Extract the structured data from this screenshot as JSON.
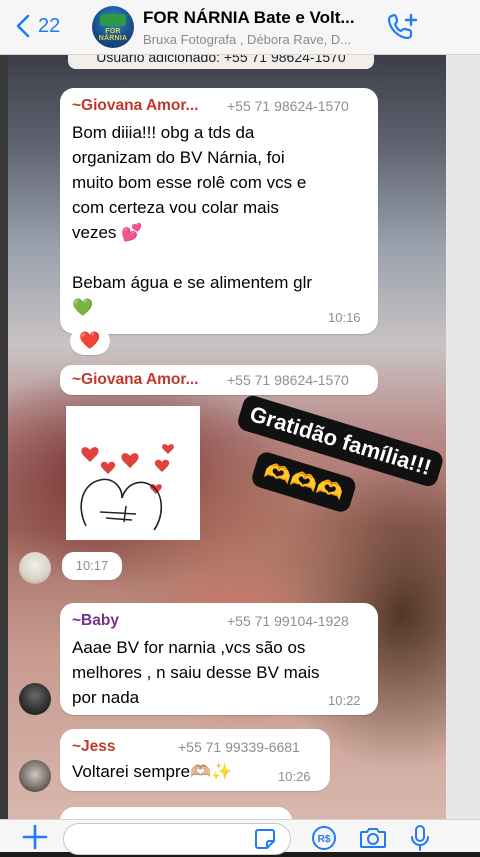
{
  "header": {
    "back_count": "22",
    "title": "FOR NÁRNIA Bate e Volt...",
    "subtitle": "Bruxa Fotografa , Débora Rave, D...",
    "avatar_logo_text": "FOR NÁRNIA",
    "icons": {
      "back": "chevron-left-icon",
      "call": "add-call-icon"
    }
  },
  "system_message": "Usuário adicionado: +55 71 98624-1570",
  "messages": [
    {
      "sender": "~Giovana Amor...",
      "phone": "+55 71 98624-1570",
      "sender_color": "#c0392b",
      "lines": [
        "Bom diiia!!! obg a tds da",
        "organizam do BV Nárnia, foi",
        "muito bom esse rolê com vcs e",
        "com certeza vou colar mais",
        "vezes 💕",
        "",
        "Bebam água e se alimentem glr",
        "💚"
      ],
      "time": "10:16",
      "reaction": "❤️"
    },
    {
      "sender": "~Giovana Amor...",
      "phone": "+55 71 98624-1570",
      "sender_color": "#c0392b",
      "sticker": "hearts-hug-sticker",
      "time": "10:17"
    },
    {
      "sender": "~Baby",
      "phone": "+55 71 99104-1928",
      "sender_color": "#7a2f8c",
      "lines": [
        "Aaae BV for narnia ,vcs são  os",
        "melhores , n saiu desse BV mais",
        "por nada"
      ],
      "time": "10:22"
    },
    {
      "sender": "~Jess",
      "phone": "+55 71 99339-6681",
      "sender_color": "#c0392b",
      "lines": [
        "Voltarei sempre🫶🏼✨"
      ],
      "time": "10:26"
    }
  ],
  "overlay": {
    "line1": "Gratidão família!!!",
    "line2": "🫶🫶🫶"
  },
  "input": {
    "placeholder": "",
    "icons": [
      "plus-icon",
      "sticker-icon",
      "payment-icon",
      "camera-icon",
      "microphone-icon"
    ]
  },
  "colors": {
    "accent": "#1f7cf6",
    "bubble": "#ffffff",
    "header_bg": "#f6f6f6"
  }
}
